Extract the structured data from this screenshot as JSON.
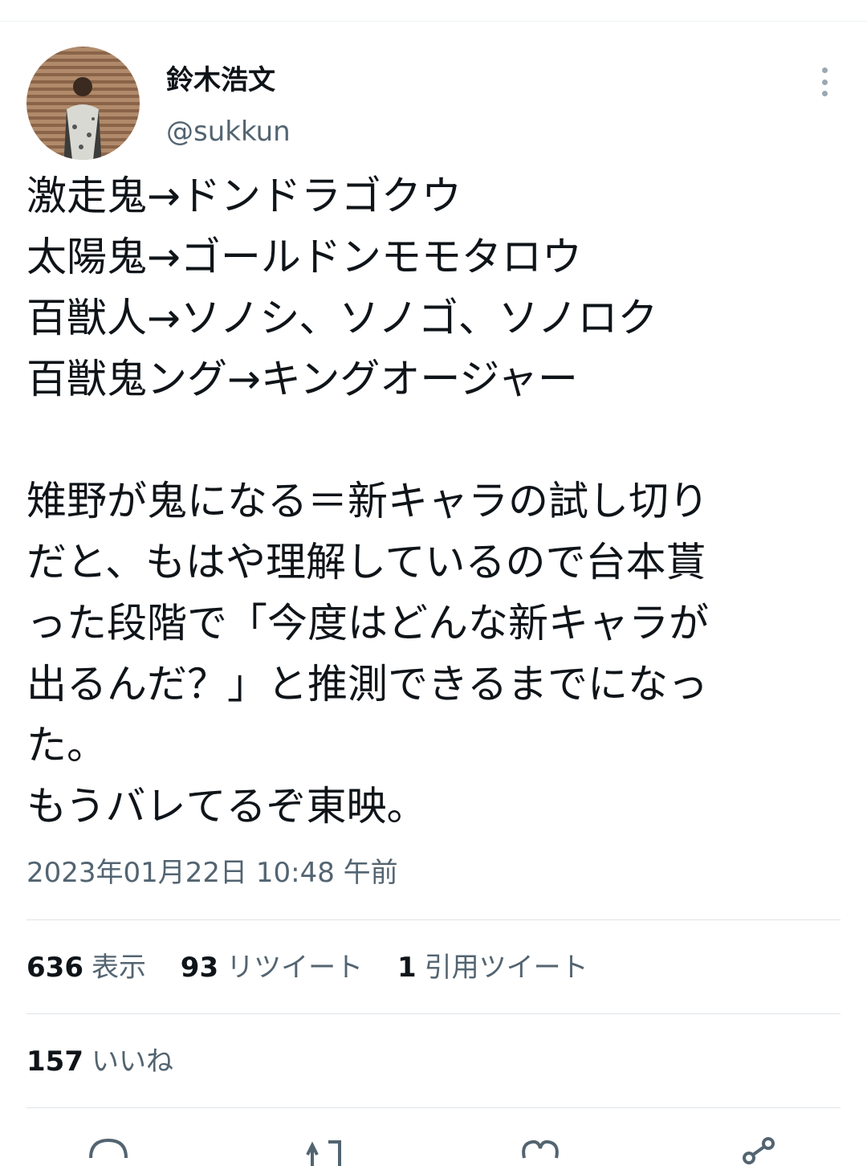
{
  "author": {
    "name": "鈴木浩文",
    "handle": "@sukkun"
  },
  "tweet": {
    "lines": [
      "激走鬼→ドンドラゴクウ",
      "太陽鬼→ゴールドンモモタロウ",
      "百獣人→ソノシ、ソノゴ、ソノロク",
      "百獣鬼ング→キングオージャー",
      "",
      "雉野が鬼になる＝新キャラの試し切り",
      "だと、もはや理解しているので台本貰",
      "った段階で「今度はどんな新キャラが",
      "出るんだ？」と推測できるまでになっ",
      "た。",
      "もうバレてるぞ東映。"
    ],
    "timestamp": "2023年01月22日 10:48 午前"
  },
  "stats": {
    "views_count": "636",
    "views_label": "表示",
    "retweets_count": "93",
    "retweets_label": "リツイート",
    "quotes_count": "1",
    "quotes_label": "引用ツイート",
    "likes_count": "157",
    "likes_label": "いいね"
  },
  "icons": {
    "more": "more-vertical-icon",
    "reply": "reply-icon",
    "retweet": "retweet-icon",
    "like": "like-icon",
    "share": "share-icon"
  },
  "colors": {
    "text": "#0f1419",
    "secondary": "#536471",
    "divider": "#dfe4e7"
  }
}
